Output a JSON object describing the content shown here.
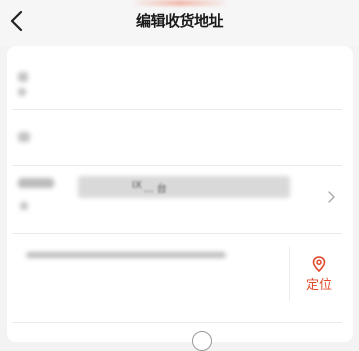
{
  "header": {
    "title": "编辑收货地址",
    "back_icon": "chevron-left-icon"
  },
  "form": {
    "region_partial": "... 台",
    "region_suffix": "IX"
  },
  "locate": {
    "label": "定位",
    "icon": "location-pin-icon",
    "color": "#e04a2a"
  }
}
